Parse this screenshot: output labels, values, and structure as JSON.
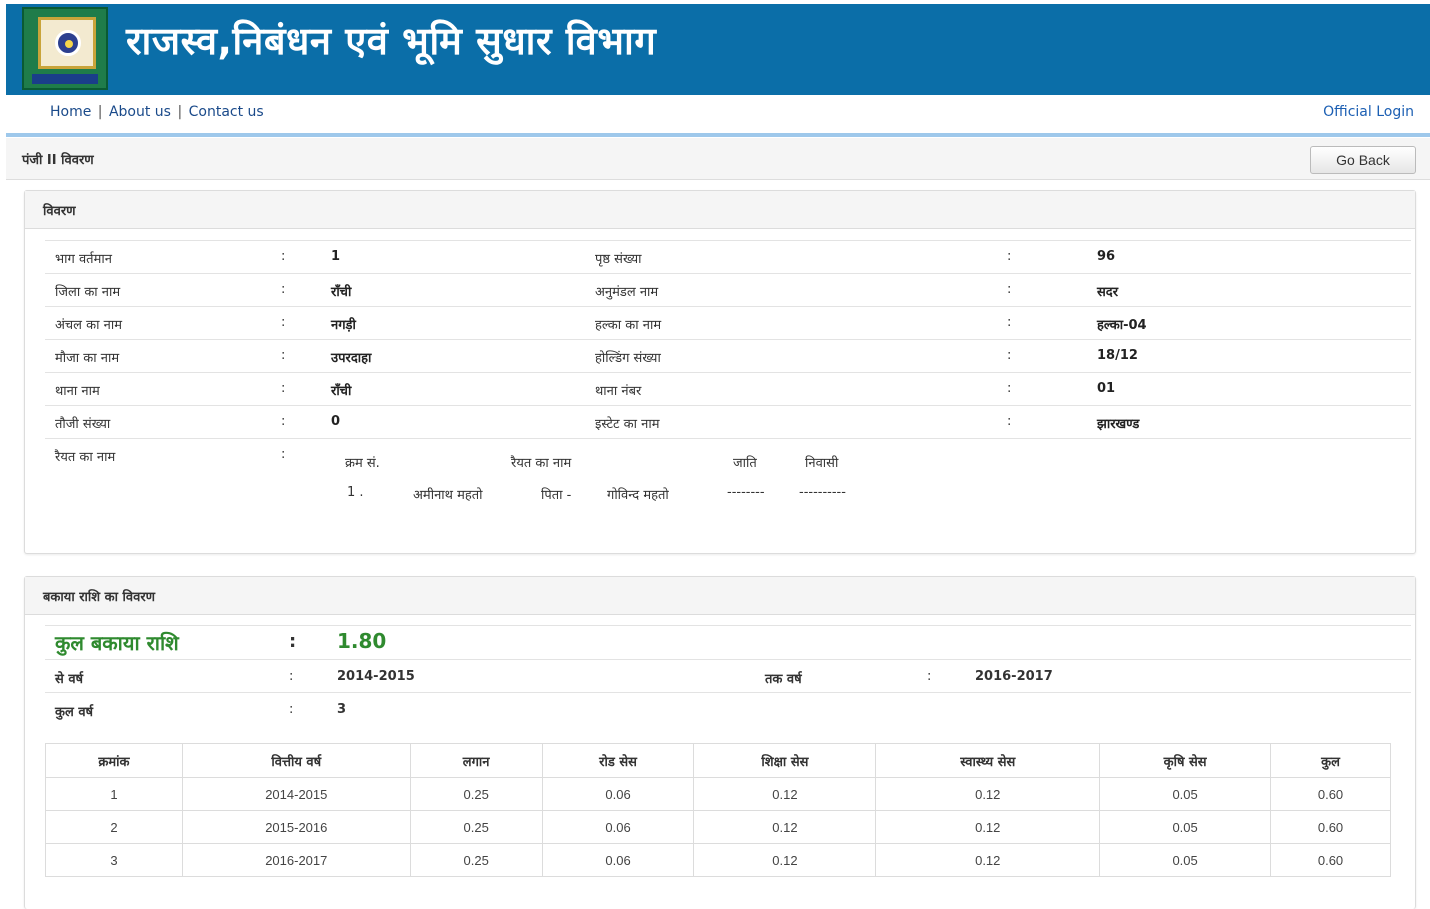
{
  "header": {
    "title": "राजस्व,निबंधन एवं भूमि सुधार विभाग",
    "colors": {
      "banner": "#0b6ea8",
      "accent_green": "#2f8a2f",
      "nav_line": "#9ec8eb"
    }
  },
  "nav": {
    "home": "Home",
    "about": "About us",
    "contact": "Contact us",
    "sep": "|",
    "login": "Official Login"
  },
  "breadcrumb": {
    "text": "पंजी II विवरण",
    "go_back": "Go Back"
  },
  "details": {
    "heading": "विवरण",
    "colon": ":",
    "rows": [
      {
        "l1": "भाग वर्तमान",
        "v1": "1",
        "l2": "पृष्ठ संख्या",
        "v2": "96"
      },
      {
        "l1": "जिला का नाम",
        "v1": "राँची",
        "l2": "अनुमंडल नाम",
        "v2": "सदर"
      },
      {
        "l1": "अंचल का नाम",
        "v1": "नगड़ी",
        "l2": "हल्का का नाम",
        "v2": "हल्का-04"
      },
      {
        "l1": "मौजा का नाम",
        "v1": "उपरदाहा",
        "l2": "होल्डिंग संख्या",
        "v2": "18/12"
      },
      {
        "l1": "थाना नाम",
        "v1": "राँची",
        "l2": "थाना नंबर",
        "v2": "01"
      },
      {
        "l1": "तौजी संख्या",
        "v1": "0",
        "l2": "इस्टेट का नाम",
        "v2": "झारखण्ड"
      }
    ],
    "raiyat": {
      "label": "रैयत का नाम",
      "headers": {
        "sno": "क्रम सं.",
        "name": "रैयत का नाम",
        "caste": "जाति",
        "resident": "निवासी"
      },
      "rows": [
        {
          "sno": "1 .",
          "name": "अमीनाथ महतो",
          "father_label": "पिता -",
          "father": "गोविन्द महतो",
          "caste": "--------",
          "resident": "----------"
        }
      ]
    }
  },
  "dues": {
    "heading": "बकाया राशि का विवरण",
    "total_label": "कुल बकाया राशि",
    "total_value": "1.80",
    "from_year_label": "से वर्ष",
    "from_year": "2014-2015",
    "to_year_label": "तक वर्ष",
    "to_year": "2016-2017",
    "total_years_label": "कुल वर्ष",
    "total_years": "3",
    "table": {
      "headers": [
        "क्रमांक",
        "वित्तीय वर्ष",
        "लगान",
        "रोड सेस",
        "शिक्षा सेस",
        "स्वास्थ्य सेस",
        "कृषि सेस",
        "कुल"
      ],
      "rows": [
        [
          "1",
          "2014-2015",
          "0.25",
          "0.06",
          "0.12",
          "0.12",
          "0.05",
          "0.60"
        ],
        [
          "2",
          "2015-2016",
          "0.25",
          "0.06",
          "0.12",
          "0.12",
          "0.05",
          "0.60"
        ],
        [
          "3",
          "2016-2017",
          "0.25",
          "0.06",
          "0.12",
          "0.12",
          "0.05",
          "0.60"
        ]
      ]
    }
  }
}
